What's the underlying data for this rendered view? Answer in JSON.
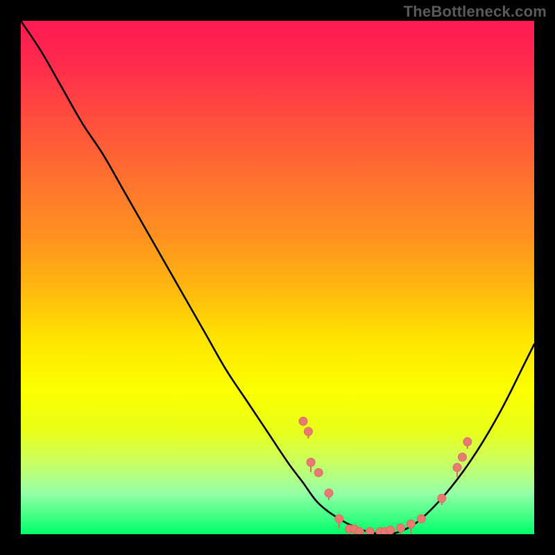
{
  "watermark": "TheBottleneck.com",
  "chart_data": {
    "type": "line",
    "title": "",
    "xlabel": "",
    "ylabel": "",
    "xlim": [
      0,
      100
    ],
    "ylim": [
      0,
      100
    ],
    "grid": false,
    "series": [
      {
        "name": "curve",
        "style": "line-black",
        "x": [
          0,
          4,
          8,
          12,
          16,
          20,
          24,
          28,
          32,
          36,
          40,
          44,
          48,
          52,
          55,
          58,
          62,
          66,
          70,
          72,
          75,
          78,
          82,
          86,
          90,
          94,
          98,
          100
        ],
        "y": [
          100,
          94,
          87,
          80,
          74,
          67,
          60,
          53,
          46,
          39,
          32,
          26,
          20,
          14,
          10,
          6,
          3,
          1,
          0,
          0,
          1,
          3,
          7,
          12,
          18,
          25,
          33,
          37
        ]
      },
      {
        "name": "points",
        "style": "scatter-salmon",
        "x": [
          55,
          56,
          56.5,
          58,
          60,
          62,
          64,
          65,
          66,
          68,
          70,
          71,
          72,
          74,
          76,
          78,
          82,
          85,
          86,
          87
        ],
        "y": [
          22,
          20,
          14,
          12,
          8,
          3,
          1,
          1,
          0.5,
          0.5,
          0.5,
          0.5,
          0.8,
          1.2,
          2,
          3,
          7,
          13,
          15,
          18
        ]
      }
    ],
    "colors": {
      "line": "#000000",
      "point_fill": "#e77b72",
      "point_stroke": "#d86a63"
    }
  }
}
